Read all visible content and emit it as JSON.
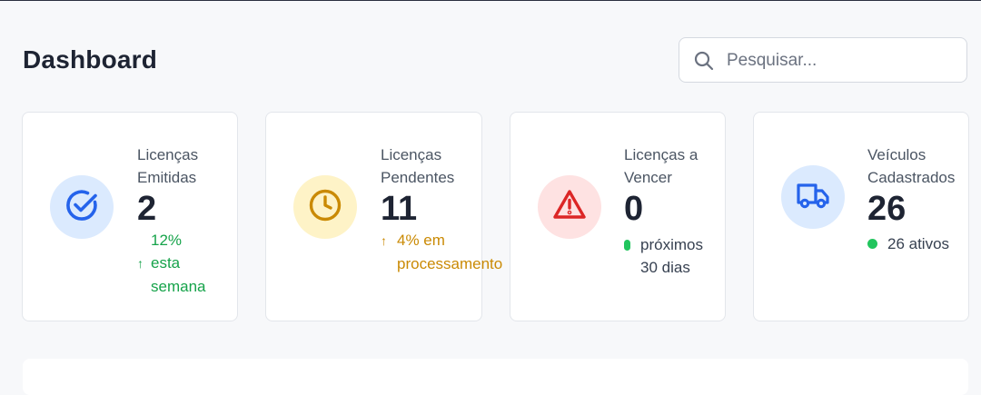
{
  "page": {
    "title": "Dashboard"
  },
  "search": {
    "placeholder": "Pesquisar...",
    "icon": "search-icon"
  },
  "stats": [
    {
      "label_line1": "Licenças",
      "label_line2": "Emitidas",
      "value": "2",
      "trend_arrow": "↑",
      "trend_line1": "12%",
      "trend_line2": "esta",
      "trend_line3": "semana",
      "icon": "check-circle-icon",
      "color": "#16a34a",
      "icon_color": "#2563eb",
      "icon_bg": "#dbeafe"
    },
    {
      "label_line1": "Licenças",
      "label_line2": "Pendentes",
      "value": "11",
      "trend_arrow": "↑",
      "trend_line1": "4% em",
      "trend_line2": "processamento",
      "icon": "clock-icon",
      "color": "#ca8a04",
      "icon_color": "#ca8a04",
      "icon_bg": "#fef3c7"
    },
    {
      "label_line1": "Licenças a",
      "label_line2": "Vencer",
      "value": "0",
      "status_line1": "próximos",
      "status_line2": "30 dias",
      "icon": "warning-triangle-icon",
      "color": "#22c55e",
      "icon_color": "#dc2626",
      "icon_bg": "#fee2e2"
    },
    {
      "label_line1": "Veículos",
      "label_line2": "Cadastrados",
      "value": "26",
      "status_line1": "26 ativos",
      "icon": "truck-icon",
      "color": "#22c55e",
      "icon_color": "#2563eb",
      "icon_bg": "#dbeafe"
    }
  ]
}
